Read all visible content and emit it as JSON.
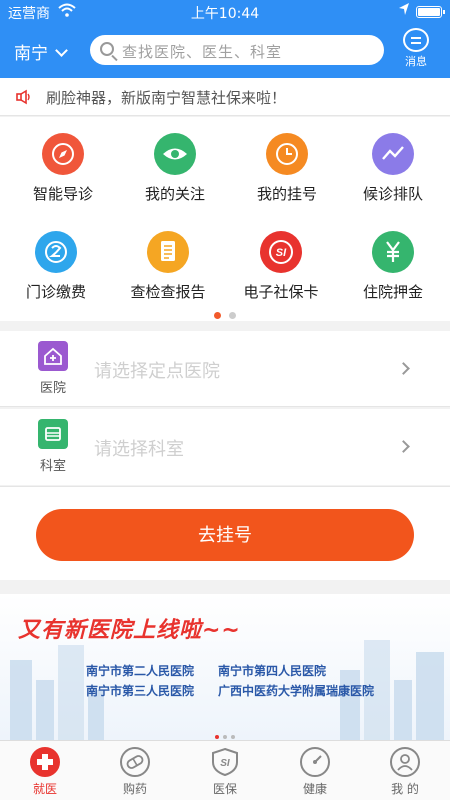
{
  "status": {
    "carrier": "运营商",
    "time": "上午10:44"
  },
  "header": {
    "city": "南宁",
    "search_placeholder": "查找医院、医生、科室",
    "message_label": "消息"
  },
  "notice": "刷脸神器，新版南宁智慧社保来啦！",
  "services": [
    {
      "label": "智能导诊",
      "icon": "compass-icon",
      "color": "#f0563a"
    },
    {
      "label": "我的关注",
      "icon": "eye-icon",
      "color": "#35b56e"
    },
    {
      "label": "我的挂号",
      "icon": "clock-icon",
      "color": "#f58a22"
    },
    {
      "label": "候诊排队",
      "icon": "trend-icon",
      "color": "#8b7be8"
    },
    {
      "label": "门诊缴费",
      "icon": "coin-icon",
      "color": "#2ea6ec"
    },
    {
      "label": "查检查报告",
      "icon": "report-icon",
      "color": "#f5a623"
    },
    {
      "label": "电子社保卡",
      "icon": "si-card-icon",
      "color": "#e8332e"
    },
    {
      "label": "住院押金",
      "icon": "yuan-icon",
      "color": "#35b56e"
    }
  ],
  "colors": {
    "brand": "#2f8ff5",
    "primary_button": "#f2551c",
    "hospital_icon": "#9b59d0",
    "dept_icon": "#35b56e"
  },
  "select": {
    "hospital": {
      "caption": "医院",
      "placeholder": "请选择定点医院"
    },
    "department": {
      "caption": "科室",
      "placeholder": "请选择科室"
    }
  },
  "register_button": "去挂号",
  "banner": {
    "headline": "又有新医院上线啦~~",
    "hospitals": [
      "南宁市第二人民医院",
      "南宁市第四人民医院",
      "南宁市第三人民医院",
      "广西中医药大学附属瑞康医院"
    ]
  },
  "tabs": [
    {
      "label": "就医",
      "icon": "medical-cross-icon"
    },
    {
      "label": "购药",
      "icon": "pill-icon"
    },
    {
      "label": "医保",
      "icon": "shield-si-icon"
    },
    {
      "label": "健康",
      "icon": "gauge-icon"
    },
    {
      "label": "我 的",
      "icon": "user-icon"
    }
  ]
}
